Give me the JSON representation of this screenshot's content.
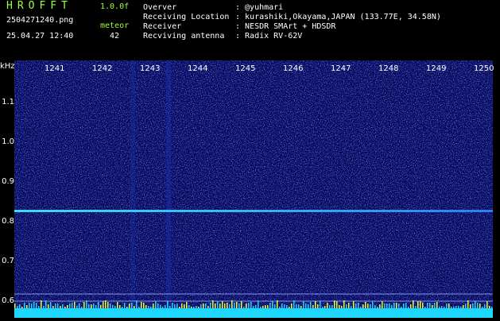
{
  "header": {
    "logo": "HROFFT",
    "version": "1.0.0f",
    "filename": "2504271240.png",
    "datetime": "25.04.27 12:40",
    "mode_label": "meteor",
    "count": "42",
    "info_labels": [
      "Overver",
      "Receiving Location",
      "Receiver",
      "Recviving antenna"
    ],
    "info_values": [
      ": @yuhmari",
      ": kurashiki,Okayama,JAPAN (133.77E, 34.58N)",
      ": NESDR SMArt + HDSDR",
      ": Radix RV-62V"
    ]
  },
  "axes": {
    "y_unit": "kHz",
    "y_ticks": [
      "1.1",
      "1.0",
      "0.9",
      "0.8",
      "0.7",
      "0.6"
    ],
    "x_ticks": [
      "1241",
      "1242",
      "1243",
      "1244",
      "1245",
      "1246",
      "1247",
      "1248",
      "1249",
      "1250"
    ]
  },
  "colors": {
    "background": "#000000",
    "plot": "#0a0a5a",
    "signal": "#35d6ff",
    "text_green": "#9cff3a"
  }
}
